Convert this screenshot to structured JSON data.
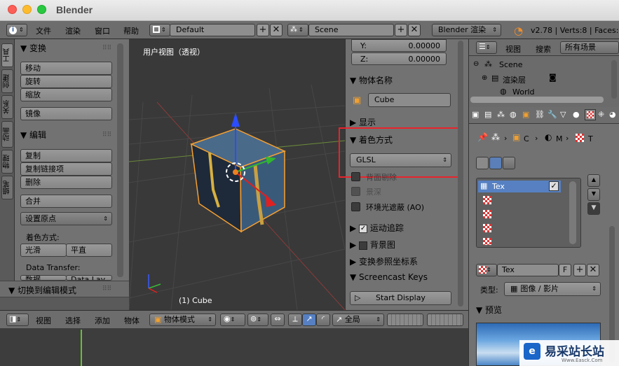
{
  "window": {
    "title": "Blender"
  },
  "infobar": {
    "menus": [
      "文件",
      "渲染",
      "窗口",
      "帮助"
    ],
    "layout": "Default",
    "scene": "Scene",
    "engine": "Blender 渲染",
    "stats": "v2.78 | Verts:8 | Faces:6"
  },
  "tabs": [
    "工具",
    "创建",
    "关系",
    "动画",
    "物理",
    "蜡笔"
  ],
  "shelf": {
    "transform_title": "变换",
    "transform_buttons": [
      "移动",
      "旋转",
      "缩放"
    ],
    "mirror": "镜像",
    "edit_title": "编辑",
    "edit_buttons": [
      "复制",
      "复制链接项",
      "删除"
    ],
    "join": "合并",
    "set_origin": "设置原点",
    "shading_label": "着色方式:",
    "smooth": "光滑",
    "flat": "平直",
    "data_transfer_label": "Data Transfer:",
    "data_btn1": "数据",
    "data_btn2": "Data Lay",
    "toggle_edit": "切换到编辑模式"
  },
  "viewport": {
    "label": "用户视图（透视）",
    "object": "(1) Cube"
  },
  "props": {
    "y_label": "Y:",
    "y_value": "0.00000",
    "z_label": "Z:",
    "z_value": "0.00000",
    "object_name_title": "物体名称",
    "object_name": "Cube",
    "display_title": "显示",
    "shading_title": "着色方式",
    "shading_mode": "GLSL",
    "backface": "背面剔除",
    "depth": "景深",
    "ao": "环境光遮蔽 (AO)",
    "motion_tracking": "运动追踪",
    "background": "背景图",
    "transform_orient": "变换参照坐标系",
    "screencast": "Screencast Keys",
    "start_display": "Start Display"
  },
  "timeline": {
    "menus": [
      "视图",
      "选择",
      "添加",
      "物体"
    ],
    "mode": "物体模式",
    "pivot": "全局"
  },
  "outliner": {
    "view": "视图",
    "search": "搜索",
    "filter": "所有场景",
    "items": [
      "Scene",
      "渲染层",
      "World"
    ]
  },
  "rprops": {
    "crumbs": [
      "C",
      "M",
      "T"
    ],
    "tex_item": "Tex",
    "tex_name": "Tex",
    "tex_flag": "F",
    "type_label": "类型:",
    "type_value": "图像 / 影片",
    "preview_title": "预览"
  },
  "watermark": {
    "text": "易采站长站",
    "sub": "Www.Easck.Com"
  }
}
